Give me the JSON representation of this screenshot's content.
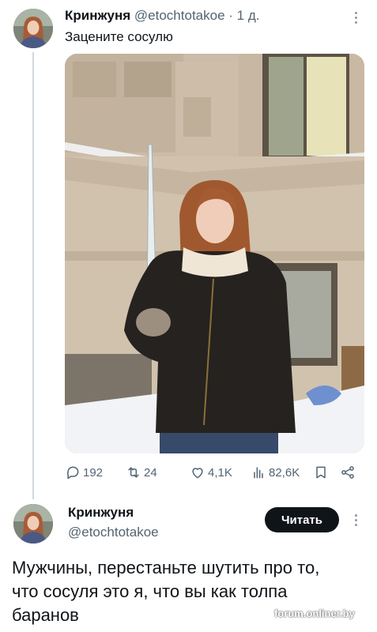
{
  "tweet": {
    "author_name": "Кринжуня",
    "author_handle": "@etochtotakoe",
    "separator": "·",
    "time_ago": "1 д.",
    "text": "Зацените сосулю",
    "stats": {
      "replies": "192",
      "retweets": "24",
      "likes": "4,1K",
      "views": "82,6K"
    }
  },
  "reply": {
    "author_name": "Кринжуня",
    "author_handle": "@etochtotakoe",
    "follow_label": "Читать",
    "text": "Мужчины, перестаньте шутить про то, что сосуля это я, что вы как толпа баранов"
  },
  "watermark": "forum.onliner.by",
  "icons": {
    "reply": "speech-bubble-icon",
    "retweet": "retweet-arrows-icon",
    "like": "heart-icon",
    "views": "bar-chart-icon",
    "bookmark": "bookmark-icon",
    "share": "share-icon",
    "more": "vertical-dots-icon"
  },
  "colors": {
    "text": "#0f1419",
    "secondary_text": "#536471",
    "thread_line": "#cfd9de",
    "follow_button": "#0f1419"
  }
}
